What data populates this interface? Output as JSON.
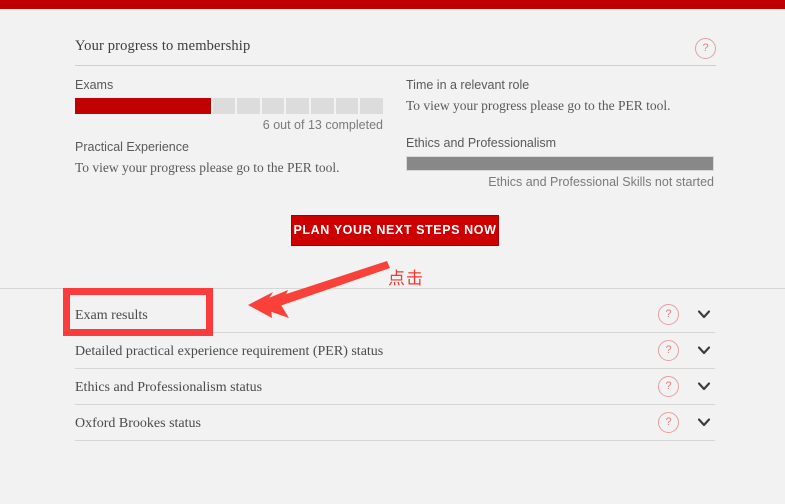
{
  "colors": {
    "brand_red": "#c00000",
    "button_red": "#cc0000",
    "annotation_red": "#fa3c3c",
    "progress_filled": "#c00000",
    "progress_empty": "#dcdcdc",
    "ethics_bar_gray": "#888888",
    "page_background": "#f2f2f2",
    "help_icon_pink": "#d98282"
  },
  "progress_card": {
    "title": "Your progress to membership",
    "help_icon": "question-mark-icon",
    "help_icon_label": "?",
    "left_column": [
      {
        "label": "Exams",
        "type": "segmented-progress",
        "segments_total": 13,
        "segments_filled": 6,
        "caption": "6 out of 13 completed"
      },
      {
        "label": "Practical Experience",
        "type": "note",
        "note": "To view your progress please go to the PER tool."
      }
    ],
    "right_column": [
      {
        "label": "Time in a relevant role",
        "type": "note",
        "note": "To view your progress please go to the PER tool."
      },
      {
        "label": "Ethics and Professionalism",
        "type": "plain-progress",
        "caption": "Ethics and Professional Skills not started"
      }
    ]
  },
  "cta": {
    "label": "PLAN YOUR NEXT STEPS NOW"
  },
  "accordion": {
    "rows": [
      {
        "label": "Exam results",
        "help_icon": "question-mark-icon",
        "help_icon_label": "?",
        "chevron_icon": "chevron-down-icon"
      },
      {
        "label": "Detailed practical experience requirement (PER) status",
        "help_icon": "question-mark-icon",
        "help_icon_label": "?",
        "chevron_icon": "chevron-down-icon"
      },
      {
        "label": "Ethics and Professionalism status",
        "help_icon": "question-mark-icon",
        "help_icon_label": "?",
        "chevron_icon": "chevron-down-icon"
      },
      {
        "label": "Oxford Brookes status",
        "help_icon": "question-mark-icon",
        "help_icon_label": "?",
        "chevron_icon": "chevron-down-icon"
      }
    ]
  },
  "annotation": {
    "text": "点击",
    "arrow_icon": "arrow-pointing-left-icon",
    "highlight_target": "Exam results"
  }
}
